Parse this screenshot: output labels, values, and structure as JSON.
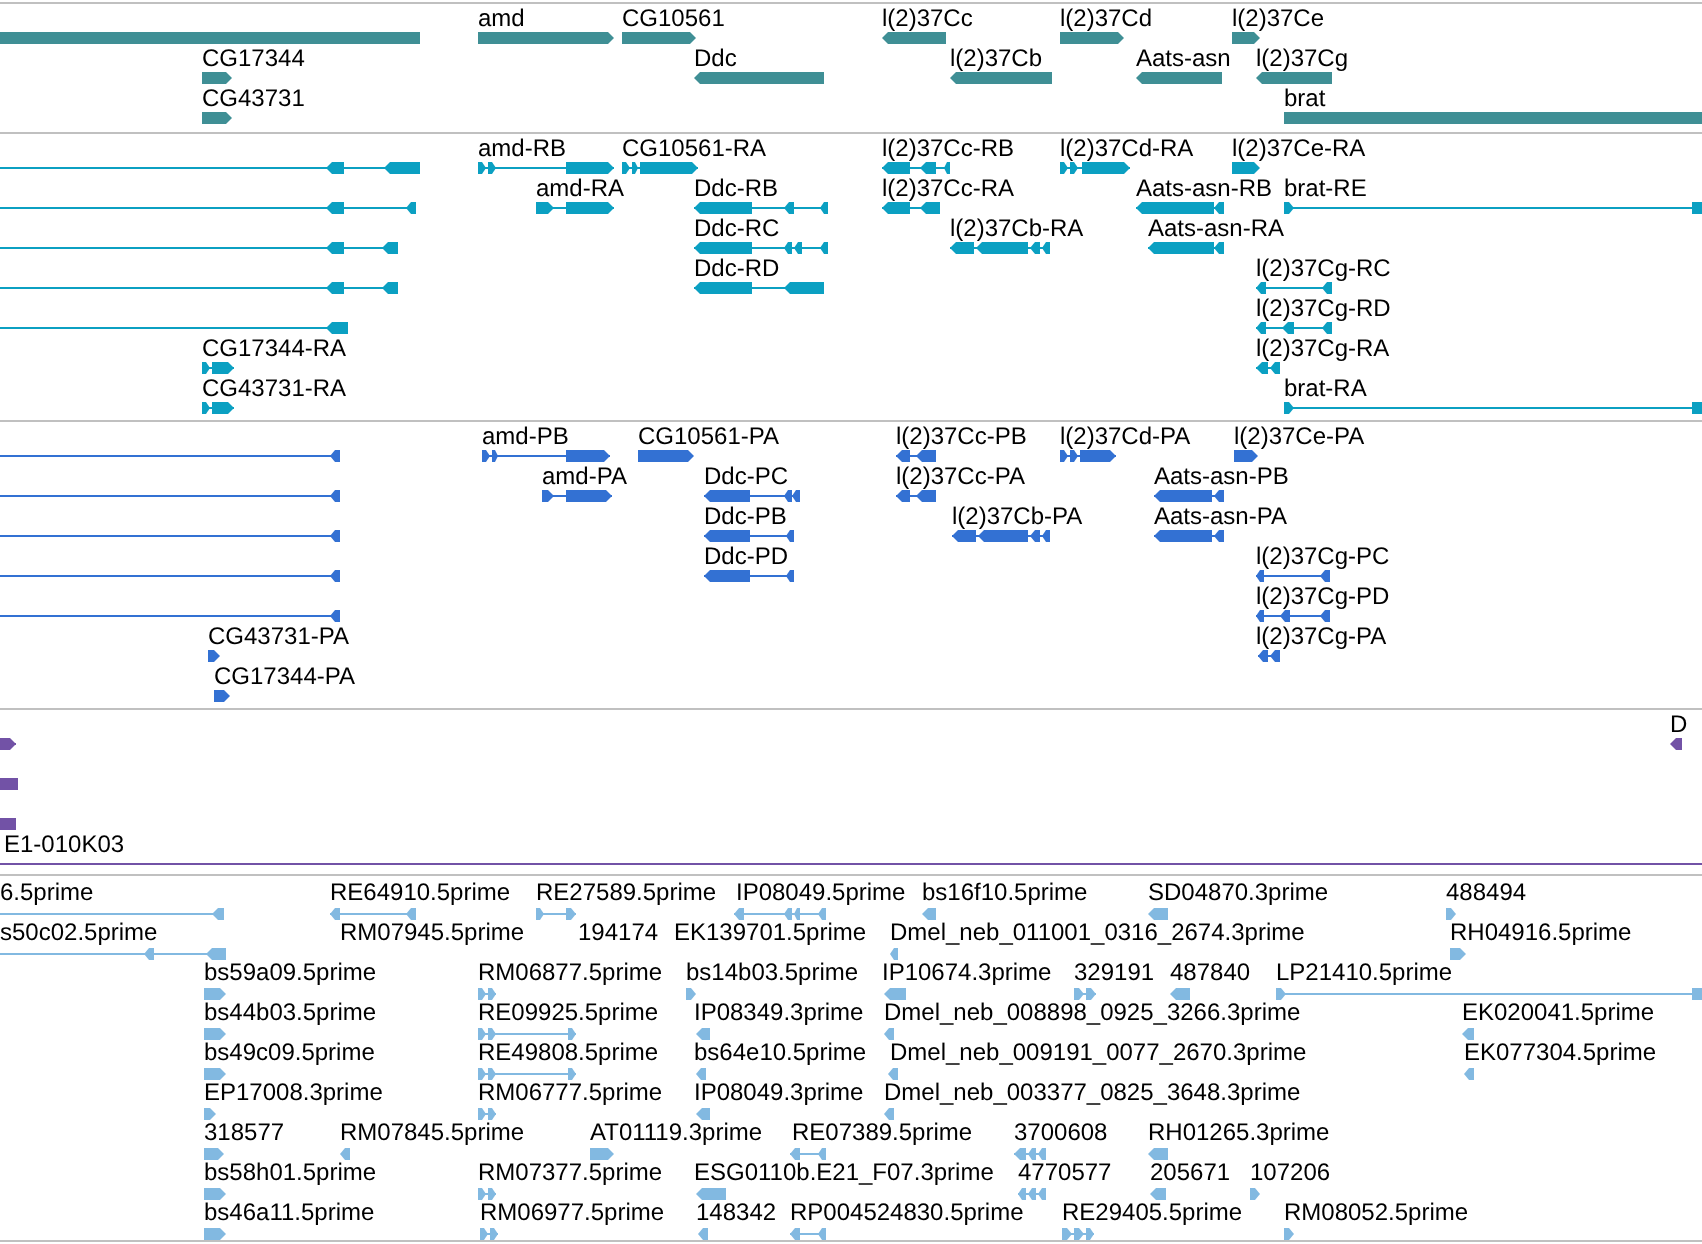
{
  "tracks": [
    {
      "color": "#3f8f95",
      "features": [
        {
          "forward": false
        },
        {
          "label": "amd",
          "forward": true
        },
        {
          "label": "CG10561",
          "forward": true
        },
        {
          "label": "l(2)37Cc",
          "forward": false
        },
        {
          "label": "l(2)37Cd",
          "forward": true
        },
        {
          "label": "l(2)37Ce",
          "forward": true
        },
        {
          "label": "CG17344",
          "forward": true
        },
        {
          "label": "Ddc",
          "forward": false
        },
        {
          "label": "l(2)37Cb",
          "forward": false
        },
        {
          "label": "Aats-asn",
          "forward": false
        },
        {
          "label": "l(2)37Cg",
          "forward": false
        },
        {
          "label": "CG43731",
          "forward": true
        },
        {
          "label": "brat",
          "forward": true
        }
      ]
    },
    {
      "color": "#0ba0c2",
      "features": [
        {
          "forward": false
        },
        {
          "label": "amd-RB",
          "forward": true
        },
        {
          "label": "CG10561-RA",
          "forward": true
        },
        {
          "label": "l(2)37Cc-RB",
          "forward": false
        },
        {
          "label": "l(2)37Cd-RA",
          "forward": true
        },
        {
          "label": "l(2)37Ce-RA",
          "forward": true
        },
        {
          "forward": false
        },
        {
          "label": "amd-RA",
          "forward": true
        },
        {
          "label": "Ddc-RB",
          "forward": false
        },
        {
          "label": "l(2)37Cc-RA",
          "forward": false
        },
        {
          "label": "Aats-asn-RB",
          "forward": false
        },
        {
          "label": "brat-RE",
          "forward": true
        },
        {
          "forward": false
        },
        {
          "label": "Ddc-RC",
          "forward": false
        },
        {
          "label": "l(2)37Cb-RA",
          "forward": false
        },
        {
          "label": "Aats-asn-RA",
          "forward": false
        },
        {
          "forward": false
        },
        {
          "label": "Ddc-RD",
          "forward": false
        },
        {
          "label": "l(2)37Cg-RC",
          "forward": false
        },
        {
          "forward": false
        },
        {
          "label": "l(2)37Cg-RD",
          "forward": false
        },
        {
          "label": "CG17344-RA",
          "forward": true
        },
        {
          "label": "l(2)37Cg-RA",
          "forward": false
        },
        {
          "label": "CG43731-RA",
          "forward": true
        },
        {
          "label": "brat-RA",
          "forward": true
        }
      ]
    },
    {
      "color": "#3371d3",
      "features": [
        {
          "forward": false
        },
        {
          "label": "amd-PB",
          "forward": true
        },
        {
          "label": "CG10561-PA",
          "forward": true
        },
        {
          "label": "l(2)37Cc-PB",
          "forward": false
        },
        {
          "label": "l(2)37Cd-PA",
          "forward": true
        },
        {
          "label": "l(2)37Ce-PA",
          "forward": true
        },
        {
          "forward": false
        },
        {
          "label": "amd-PA",
          "forward": true
        },
        {
          "label": "Ddc-PC",
          "forward": false
        },
        {
          "label": "l(2)37Cc-PA",
          "forward": false
        },
        {
          "label": "Aats-asn-PB",
          "forward": false
        },
        {
          "forward": false
        },
        {
          "label": "Ddc-PB",
          "forward": false
        },
        {
          "label": "l(2)37Cb-PA",
          "forward": false
        },
        {
          "label": "Aats-asn-PA",
          "forward": false
        },
        {
          "forward": false
        },
        {
          "label": "Ddc-PD",
          "forward": false
        },
        {
          "label": "l(2)37Cg-PC",
          "forward": false
        },
        {
          "forward": false
        },
        {
          "label": "l(2)37Cg-PD",
          "forward": false
        },
        {
          "label": "CG43731-PA",
          "forward": true
        },
        {
          "label": "l(2)37Cg-PA",
          "forward": false
        },
        {
          "label": "CG17344-PA",
          "forward": true
        }
      ]
    },
    {
      "color": "#7252a6",
      "features": [
        {
          "forward": true
        },
        {
          "label": "D",
          "forward": false
        },
        {
          "forward": false
        },
        {
          "forward": false
        },
        {
          "label": "E1-010K03"
        }
      ]
    },
    {
      "color": "#82b9e1",
      "features": [
        {
          "label": "6.5prime",
          "forward": false
        },
        {
          "label": "RE64910.5prime",
          "forward": false
        },
        {
          "label": "RE27589.5prime",
          "forward": true
        },
        {
          "label": "IP08049.5prime",
          "forward": false
        },
        {
          "label": "bs16f10.5prime",
          "forward": false
        },
        {
          "label": "SD04870.3prime",
          "forward": false
        },
        {
          "label": "488494",
          "forward": true
        },
        {
          "label": "s50c02.5prime",
          "forward": false
        },
        {
          "label": "RM07945.5prime"
        },
        {
          "label": "194174"
        },
        {
          "label": "EK139701.5prime"
        },
        {
          "label": "Dmel_neb_011001_0316_2674.3prime",
          "forward": false
        },
        {
          "label": "RH04916.5prime",
          "forward": true
        },
        {
          "label": "bs59a09.5prime",
          "forward": true
        },
        {
          "label": "RM06877.5prime",
          "forward": true
        },
        {
          "label": "bs14b03.5prime",
          "forward": true
        },
        {
          "label": "IP10674.3prime",
          "forward": false
        },
        {
          "label": "329191",
          "forward": true
        },
        {
          "label": "487840",
          "forward": false
        },
        {
          "label": "LP21410.5prime",
          "forward": true
        },
        {
          "label": "bs44b03.5prime",
          "forward": true
        },
        {
          "label": "RE09925.5prime",
          "forward": true
        },
        {
          "label": "IP08349.3prime",
          "forward": false
        },
        {
          "label": "Dmel_neb_008898_0925_3266.3prime",
          "forward": false
        },
        {
          "label": "EK020041.5prime",
          "forward": false
        },
        {
          "label": "bs49c09.5prime",
          "forward": true
        },
        {
          "label": "RE49808.5prime",
          "forward": true
        },
        {
          "label": "bs64e10.5prime",
          "forward": false
        },
        {
          "label": "Dmel_neb_009191_0077_2670.3prime",
          "forward": false
        },
        {
          "label": "EK077304.5prime",
          "forward": false
        },
        {
          "label": "EP17008.3prime",
          "forward": true
        },
        {
          "label": "RM06777.5prime",
          "forward": true
        },
        {
          "label": "IP08049.3prime",
          "forward": false
        },
        {
          "label": "Dmel_neb_003377_0825_3648.3prime",
          "forward": false
        },
        {
          "label": "318577",
          "forward": true
        },
        {
          "label": "RM07845.5prime",
          "forward": false
        },
        {
          "label": "AT01119.3prime",
          "forward": true
        },
        {
          "label": "RE07389.5prime",
          "forward": false
        },
        {
          "label": "3700608",
          "forward": false
        },
        {
          "label": "RH01265.3prime",
          "forward": false
        },
        {
          "label": "bs58h01.5prime",
          "forward": true
        },
        {
          "label": "RM07377.5prime",
          "forward": true
        },
        {
          "label": "ESG0110b.E21_F07.3prime",
          "forward": false
        },
        {
          "label": "4770577",
          "forward": false
        },
        {
          "label": "205671",
          "forward": false
        },
        {
          "label": "107206",
          "forward": true
        },
        {
          "label": "bs46a11.5prime",
          "forward": true
        },
        {
          "label": "RM06977.5prime",
          "forward": true
        },
        {
          "label": "148342",
          "forward": false
        },
        {
          "label": "RP004524830.5prime",
          "forward": false
        },
        {
          "label": "RE29405.5prime",
          "forward": true
        },
        {
          "label": "RM08052.5prime",
          "forward": true
        }
      ]
    }
  ]
}
